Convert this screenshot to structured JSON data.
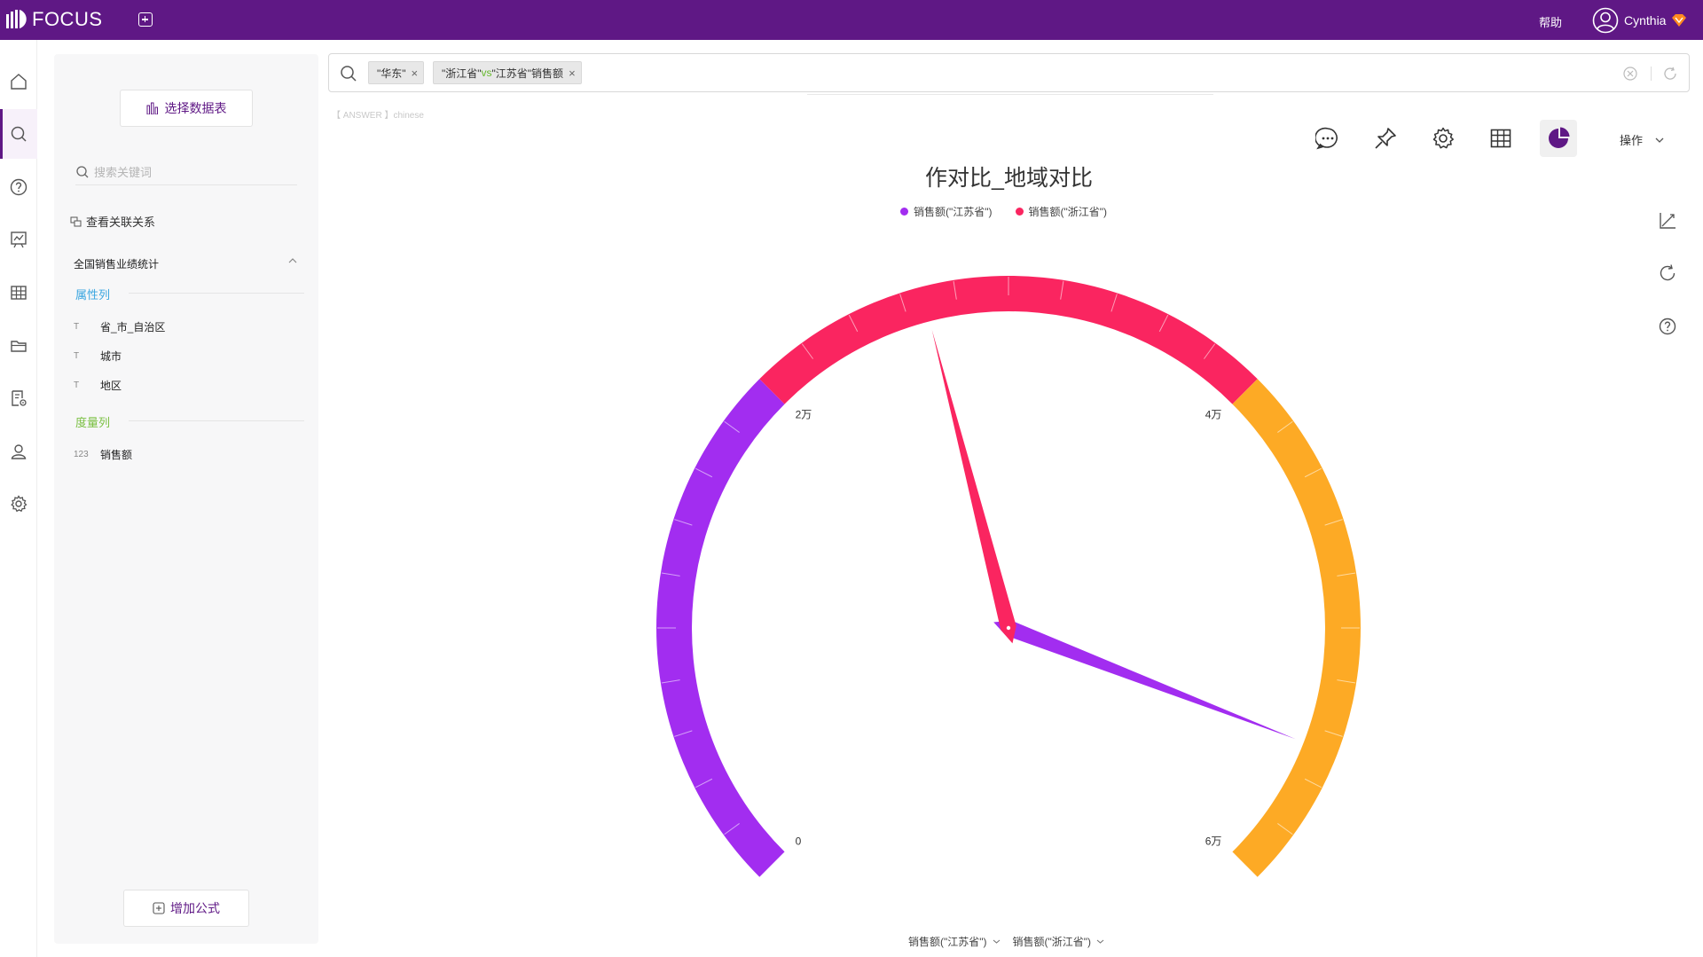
{
  "app": {
    "logo": "FOCUS"
  },
  "header": {
    "help": "帮助",
    "user": "Cynthia"
  },
  "sidebar": {
    "items": [
      {
        "name": "home-icon",
        "active": false
      },
      {
        "name": "search-icon",
        "active": true
      },
      {
        "name": "question-icon",
        "active": false
      },
      {
        "name": "board-icon",
        "active": false
      },
      {
        "name": "table-icon",
        "active": false
      },
      {
        "name": "folder-icon",
        "active": false
      },
      {
        "name": "data-settings-icon",
        "active": false
      },
      {
        "name": "user-icon",
        "active": false
      },
      {
        "name": "gear-icon",
        "active": false
      }
    ]
  },
  "panel": {
    "select_table": "选择数据表",
    "search_placeholder": "搜索关键词",
    "relation_link": "查看关联关系",
    "table_name": "全国销售业绩统计",
    "attr_title": "属性列",
    "measure_title": "度量列",
    "attr_columns": [
      {
        "type": "T",
        "name": "省_市_自治区"
      },
      {
        "type": "T",
        "name": "城市"
      },
      {
        "type": "T",
        "name": "地区"
      }
    ],
    "measure_columns": [
      {
        "type": "123",
        "name": "销售额"
      }
    ],
    "add_formula": "增加公式"
  },
  "search": {
    "tokens": [
      {
        "text": "\"华东\""
      },
      {
        "pre": "\"浙江省\"",
        "vs": "vs",
        "post": "\"江苏省\"销售额"
      }
    ]
  },
  "answer_tag": "【 ANSWER 】chinese",
  "toolbar": {
    "ops_label": "操作"
  },
  "colors": {
    "brand": "#5f1885",
    "purple_band": "#a22df0",
    "red_band": "#fa2560",
    "orange_band": "#fdaa25",
    "jiangsu": "#a22df0",
    "zhejiang": "#fa2560"
  },
  "chart_data": {
    "type": "gauge",
    "title": "作对比_地域对比",
    "min": 0,
    "max": 60000,
    "tick_labels": [
      "0",
      "2万",
      "4万",
      "6万"
    ],
    "bands": [
      {
        "from": 0,
        "to": 20000,
        "color": "#a22df0"
      },
      {
        "from": 20000,
        "to": 40000,
        "color": "#fa2560"
      },
      {
        "from": 40000,
        "to": 60000,
        "color": "#fdaa25"
      }
    ],
    "series": [
      {
        "name": "销售额(\"江苏省\")",
        "value": 54700,
        "color": "#a22df0"
      },
      {
        "name": "销售额(\"浙江省\")",
        "value": 26800,
        "color": "#fa2560"
      }
    ]
  },
  "bottom_selectors": [
    "销售额(\"江苏省\")",
    "销售额(\"浙江省\")"
  ]
}
